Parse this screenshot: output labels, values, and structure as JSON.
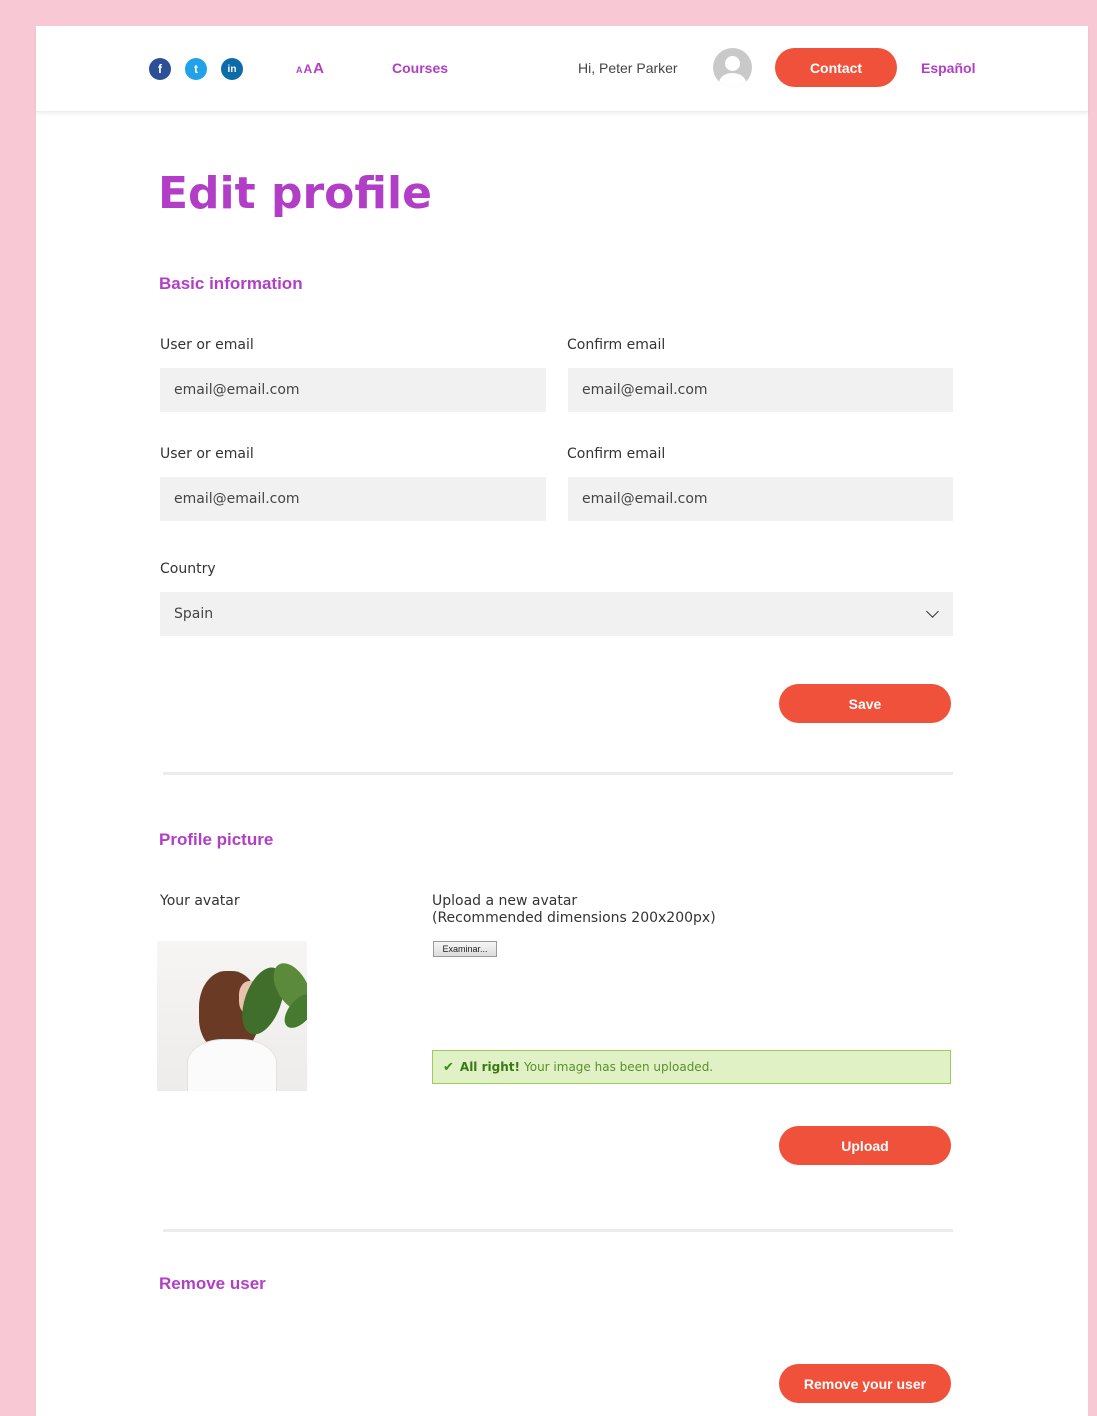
{
  "header": {
    "social": [
      "f",
      "t",
      "in"
    ],
    "font_size_controls": [
      "A",
      "A",
      "A"
    ],
    "courses": "Courses",
    "greeting": "Hi, Peter Parker",
    "contact": "Contact",
    "language": "Español"
  },
  "page": {
    "title": "Edit profile"
  },
  "basic": {
    "title": "Basic information",
    "row1": {
      "label_left": "User or email",
      "value_left": "email@email.com",
      "label_right": "Confirm email",
      "value_right": "email@email.com"
    },
    "row2": {
      "label_left": "User or email",
      "value_left": "email@email.com",
      "label_right": "Confirm email",
      "value_right": "email@email.com"
    },
    "country_label": "Country",
    "country_value": "Spain",
    "save": "Save"
  },
  "picture": {
    "title": "Profile picture",
    "your_avatar": "Your avatar",
    "upload_line1": "Upload a new avatar",
    "upload_line2": "(Recommended dimensions 200x200px)",
    "browse": "Examinar...",
    "success_strong": "All right!",
    "success_text": "Your image has been uploaded.",
    "upload": "Upload"
  },
  "remove": {
    "title": "Remove user",
    "button": "Remove your user"
  },
  "colors": {
    "accent": "#b23ec7",
    "button": "#f0513a",
    "background": "#f8c8d4"
  }
}
